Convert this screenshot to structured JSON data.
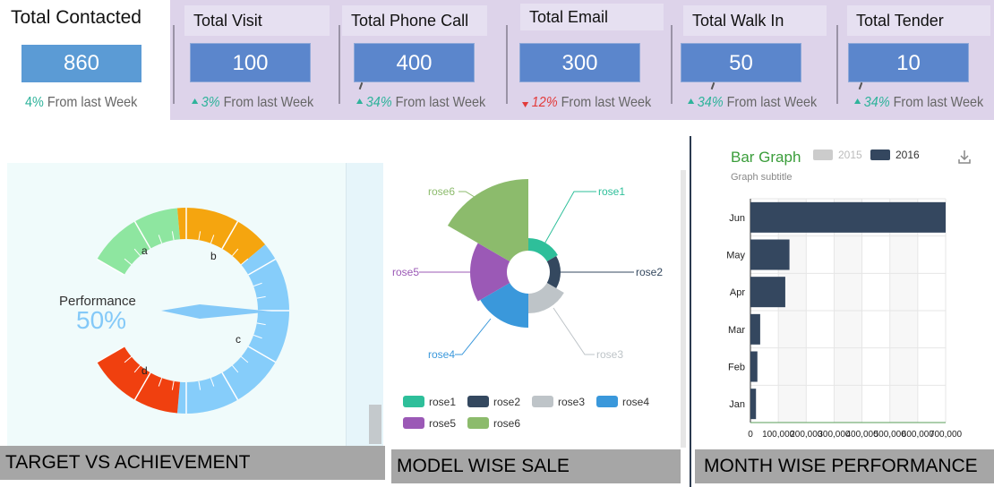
{
  "kpis": {
    "total_contacted": {
      "title": "Total Contacted",
      "value": "860",
      "change": "4%",
      "change_text": "From last Week"
    },
    "items": [
      {
        "title": "Total Visit",
        "value": "100",
        "change": "3%",
        "change_text": "From last Week",
        "direction": "up"
      },
      {
        "title": "Total Phone Call",
        "value": "400",
        "change": "34%",
        "change_text": "From last Week",
        "direction": "up"
      },
      {
        "title": "Total Email",
        "value": "300",
        "change": "12%",
        "change_text": "From last Week",
        "direction": "down"
      },
      {
        "title": "Total Walk In",
        "value": "50",
        "change": "34%",
        "change_text": "From last Week",
        "direction": "up"
      },
      {
        "title": "Total Tender",
        "value": "10",
        "change": "34%",
        "change_text": "From last Week",
        "direction": "up"
      }
    ]
  },
  "gauge": {
    "title": "Performance",
    "value_text": "50%",
    "value": 50,
    "segment_labels": [
      "a",
      "b",
      "c",
      "d"
    ],
    "colors": {
      "a": "#8ee6a0",
      "b": "#f5a50f",
      "c": "#86cdfa",
      "d": "#f0400f"
    },
    "caption": "TARGET VS ACHIEVEMENT"
  },
  "rose": {
    "caption": "MODEL WISE SALE",
    "labels": [
      "rose1",
      "rose2",
      "rose3",
      "rose4",
      "rose5",
      "rose6"
    ],
    "colors": [
      "#2ebf9a",
      "#34485f",
      "#bec4c8",
      "#3a98db",
      "#9b59b6",
      "#8cbb6c"
    ],
    "legend": [
      "rose1",
      "rose2",
      "rose3",
      "rose4",
      "rose5",
      "rose6"
    ]
  },
  "bar": {
    "caption": "MONTH WISE PERFORMANCE",
    "title": "Bar Graph",
    "subtitle": "Graph subtitle",
    "legend": [
      {
        "name": "2015",
        "color": "#cccccc",
        "active": false
      },
      {
        "name": "2016",
        "color": "#34475f",
        "active": true
      }
    ],
    "download_icon": "download-icon"
  },
  "chart_data": [
    {
      "type": "bar",
      "orientation": "horizontal",
      "title": "Bar Graph",
      "subtitle": "Graph subtitle",
      "categories": [
        "Jun",
        "May",
        "Apr",
        "Mar",
        "Feb",
        "Jan"
      ],
      "series": [
        {
          "name": "2016",
          "values": [
            700000,
            140000,
            125000,
            35000,
            25000,
            20000
          ]
        }
      ],
      "xticks": [
        "0",
        "100,000",
        "200,000",
        "300,000",
        "400,000",
        "500,000",
        "600,000",
        "700,000"
      ],
      "xlim": [
        0,
        700000
      ],
      "grid": true,
      "legend_position": "top"
    }
  ]
}
